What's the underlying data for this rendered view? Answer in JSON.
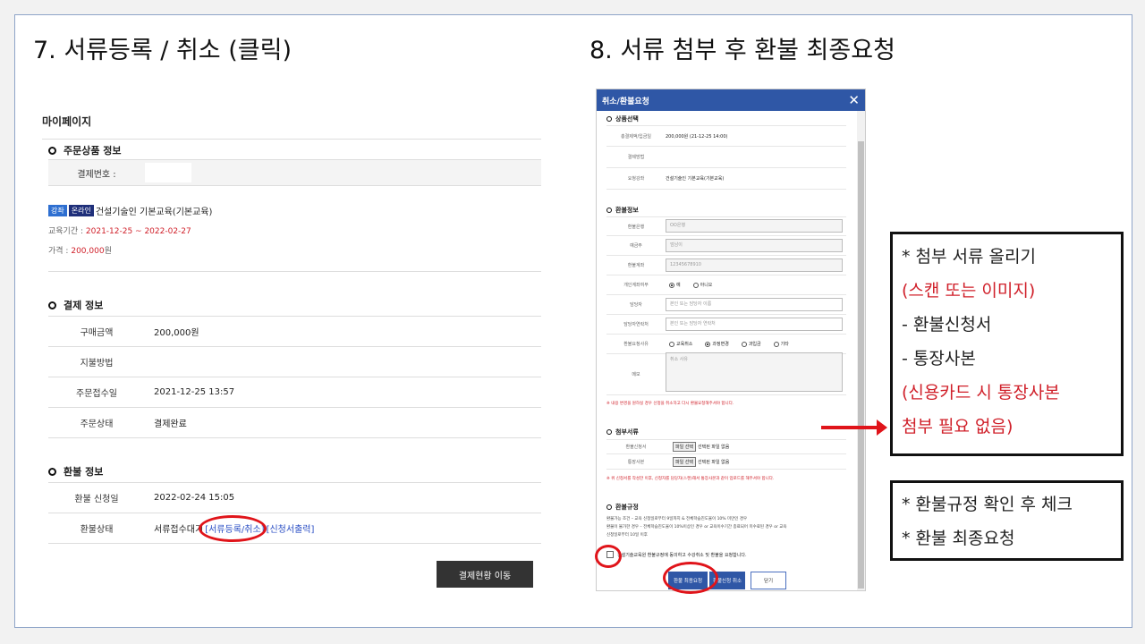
{
  "titles": {
    "left": "7. 서류등록 / 취소 (클릭)",
    "right": "8. 서류 첨부 후 환불 최종요청"
  },
  "left_panel": {
    "mypage": "마이페이지",
    "order_section": "주문상품 정보",
    "payment_no_label": "결제번호 :",
    "tag1": "강좌",
    "tag2": "온라인",
    "course_name": "건설기술인 기본교육(기본교육)",
    "period_label": "교육기간 :",
    "period_value": "2021-12-25 ~ 2022-02-27",
    "price_label": "가격 :",
    "price_value": "200,000",
    "price_unit": "원",
    "payment_section": "결제 정보",
    "payment_rows": [
      {
        "label": "구매금액",
        "value": "200,000원"
      },
      {
        "label": "지불방법",
        "value": ""
      },
      {
        "label": "주문접수일",
        "value": "2021-12-25 13:57"
      },
      {
        "label": "주문상태",
        "value": "결제완료"
      }
    ],
    "refund_section": "환불 정보",
    "refund_date_label": "환불 신청일",
    "refund_date_value": "2022-02-24 15:05",
    "refund_status_label": "환불상태",
    "refund_status_text": "서류접수대기",
    "doc_register_link": "[서류등록/취소]",
    "print_link": "[신청서출력]",
    "pay_status_button": "결제현황 이동"
  },
  "modal": {
    "title": "취소/환불요청",
    "close": "✕",
    "product_section": "상품선택",
    "product_rows": [
      {
        "label": "총결제액/입금일",
        "value": "200,000원 (21-12-25 14:00)"
      },
      {
        "label": "결제방법",
        "value": ""
      },
      {
        "label": "요청강좌",
        "value": "건설기술인 기본교육(기본교육)"
      }
    ],
    "refund_section": "환불정보",
    "refund_rows": [
      {
        "label": "환불은행",
        "value": "OO은행"
      },
      {
        "label": "예금주",
        "value": "엄남이"
      },
      {
        "label": "환불계좌",
        "value": "12345678910"
      }
    ],
    "personal_label": "개인계좌여부",
    "personal_yes": "예",
    "personal_no": "아니오",
    "manager_label": "담당자",
    "manager_placeholder": "본인 또는 담당자 이름",
    "manager_contact_label": "담당자연락처",
    "manager_contact_placeholder": "본인 또는 담당자 연락처",
    "reason_label": "환불요청사유",
    "reasons": [
      "교육취소",
      "과정변경",
      "과입금",
      "기타"
    ],
    "memo_label": "메모",
    "memo_placeholder": "취소 사유",
    "note1": "※ 내용 변경을 원하실 경우 신청을 취소하고 다시 환불요청해주셔야 합니다.",
    "attach_section": "첨부서류",
    "attach_rows": [
      {
        "label": "환불신청서",
        "button": "파일 선택",
        "status": "선택된 파일 없음"
      },
      {
        "label": "통장사본",
        "button": "파일 선택",
        "status": "선택된 파일 없음"
      }
    ],
    "note2": "※ 위 신청서를 작성한 이후, 신청자를 담당자(스캔)해서 통장사본과 같이 업로드를 해주셔야 합니다.",
    "policy_section": "환불규정",
    "policy_lines": [
      "환불가능 조건 – 교육 신청일로부터 9일까지 & 전체학습진도율이 10% 미만인 경우",
      "환불이 불가한 경우 – 전체학습진도율이 10%이상인 경우 or 교육이수기간 종료되어 미수료된 경우 or 교육",
      "신청일로부터 10일 이후"
    ],
    "agree_text": "건설기술교육원 환불규정에 동의하고 수강취소 및 환불을 요청합니다.",
    "btn_final": "환불 최종요청",
    "btn_cancel_refund": "환불신청 취소",
    "btn_close": "닫기"
  },
  "annotation1": {
    "line1": "* 첨부 서류 올리기",
    "line2": "(스캔 또는 이미지)",
    "line3": "- 환불신청서",
    "line4": "- 통장사본",
    "line5": "(신용카드 시 통장사본",
    "line6": "첨부 필요 없음)"
  },
  "annotation2": {
    "line1": "* 환불규정 확인 후 체크",
    "line2": "* 환불 최종요청"
  },
  "colors": {
    "accent_red": "#e0141a",
    "modal_blue": "#2f57a6",
    "tag_blue": "#2e6fd1",
    "tag_navy": "#1f2f7a"
  }
}
